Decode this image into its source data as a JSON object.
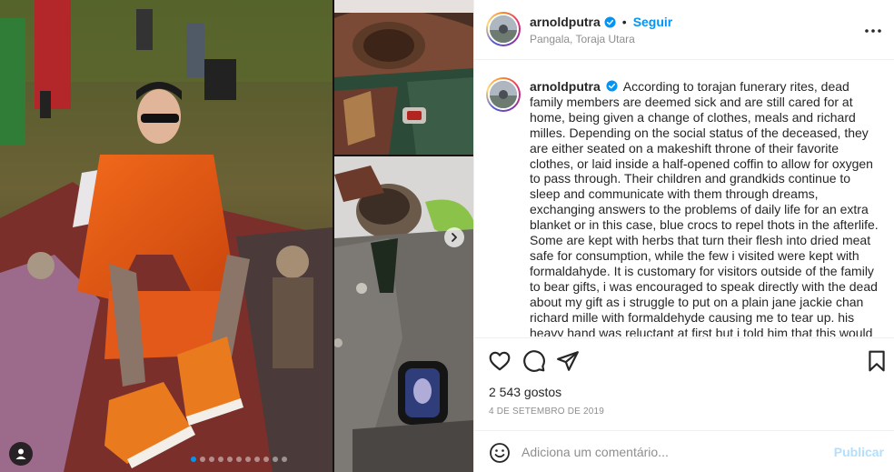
{
  "post": {
    "username": "arnoldputra",
    "follow_label": "Seguir",
    "separator": "•",
    "location": "Pangala, Toraja Utara",
    "caption": "According to torajan funerary rites, dead family members are deemed sick and are still cared for at home, being given a change of clothes, meals and richard milles. Depending on the social status of the deceased, they are either seated on a makeshift throne of their favorite clothes, or laid inside a half-opened coffin to allow for oxygen to pass through. Their children and grandkids continue to sleep and communicate with them through dreams, exchanging answers to the problems of daily life for an extra blanket or in this case, blue crocs to repel thots in the afterlife. Some are kept with herbs that turn their flesh into dried meat safe for consumption, while the few i visited were kept with formaldahyde. It is customary for visitors outside of the family to bear gifts, i was encouraged to speak directly with the dead about my gift as i struggle to put on a plain jane jackie chan richard mille with formaldehyde causing me to tear up. his heavy hand was reluctant at first but i told him that this would get him on all guest lists in the after life from jeremy scott's coachella party to drinking",
    "likes": "2 543 gostos",
    "date": "4 DE SETEMBRO DE 2019"
  },
  "comment_box": {
    "placeholder": "Adiciona um comentário...",
    "publish_label": "Publicar"
  },
  "carousel": {
    "total_slides": 11,
    "active_index": 0
  },
  "icons": {
    "like": "heart-icon",
    "comment": "comment-icon",
    "share": "send-icon",
    "save": "bookmark-icon",
    "emoji": "emoji-icon",
    "more": "more-options-icon",
    "next": "chevron-right-icon",
    "tag": "user-tag-icon",
    "verified": "verified-badge-icon"
  },
  "colors": {
    "accent": "#0095f6",
    "publish_disabled": "#b2dffc",
    "muted_text": "#8e8e8e",
    "border": "#efefef"
  }
}
